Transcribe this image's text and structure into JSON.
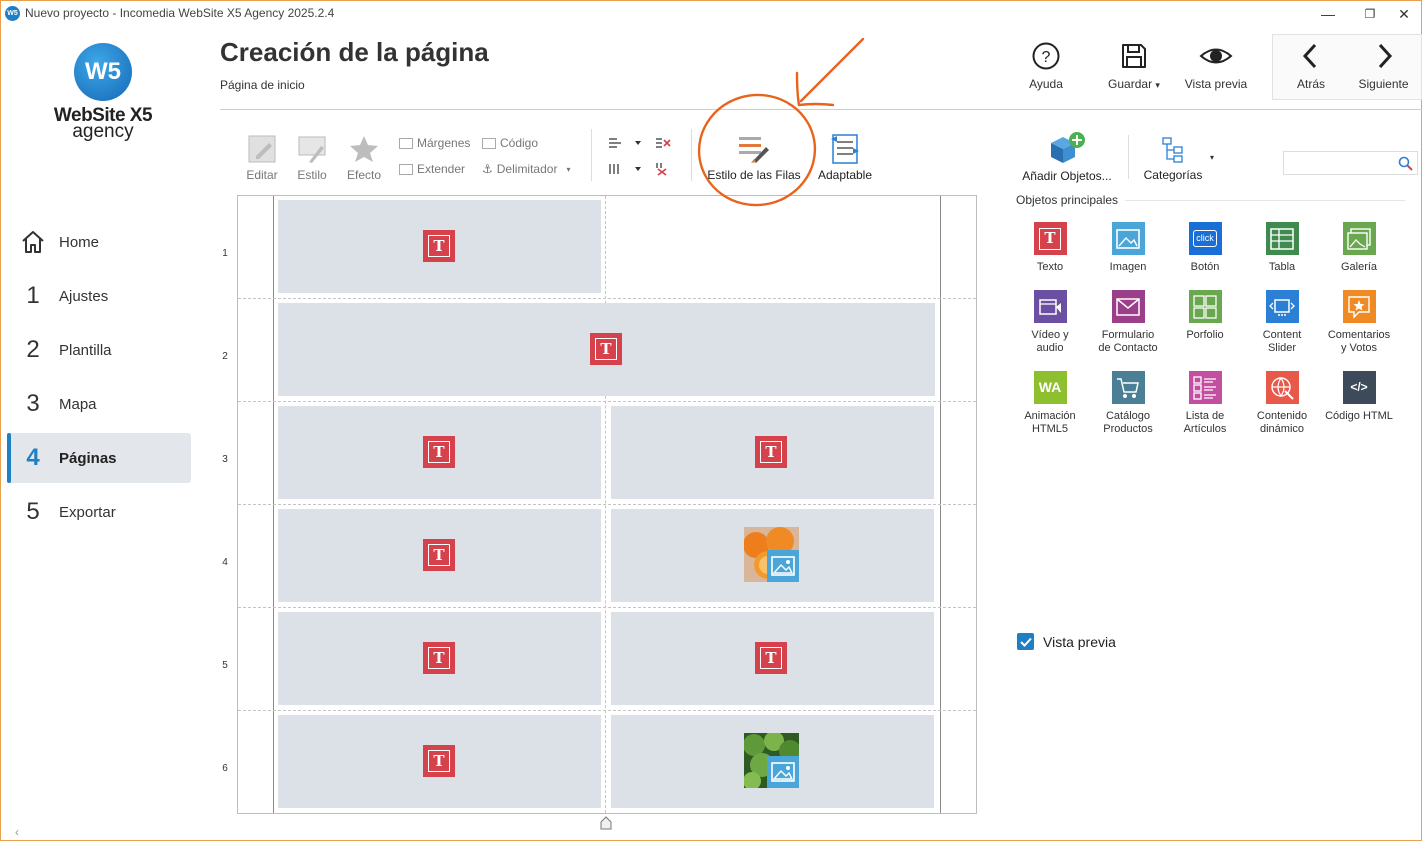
{
  "window": {
    "title": "Nuevo proyecto - Incomedia WebSite X5 Agency 2025.2.4",
    "app_icon_text": "W5",
    "controls": {
      "minimize": "—",
      "maximize": "❐",
      "close": "✕"
    }
  },
  "logo": {
    "mark": "W5",
    "name": "WebSite X5",
    "sub": "agency"
  },
  "sidebar": {
    "items": [
      {
        "num": "",
        "label": "Home",
        "active": false
      },
      {
        "num": "1",
        "label": "Ajustes",
        "active": false
      },
      {
        "num": "2",
        "label": "Plantilla",
        "active": false
      },
      {
        "num": "3",
        "label": "Mapa",
        "active": false
      },
      {
        "num": "4",
        "label": "Páginas",
        "active": true
      },
      {
        "num": "5",
        "label": "Exportar",
        "active": false
      }
    ]
  },
  "header": {
    "title": "Creación de la página",
    "subtitle": "Página de inicio",
    "help": "Ayuda",
    "save": "Guardar",
    "save_arrow": "▾",
    "preview": "Vista previa",
    "back": "Atrás",
    "next": "Siguiente"
  },
  "toolbar": {
    "edit": "Editar",
    "style": "Estilo",
    "effect": "Efecto",
    "margins": "Márgenes",
    "code": "Código",
    "extend": "Extender",
    "delimiter": "Delimitador",
    "row_style": "Estilo de las Filas",
    "adaptive": "Adaptable",
    "add_objects": "Añadir Objetos...",
    "categories": "Categorías"
  },
  "grid": {
    "rows": [
      "1",
      "2",
      "3",
      "4",
      "5",
      "6"
    ],
    "text_glyph": "T"
  },
  "objects_panel": {
    "header": "Objetos principales",
    "items": [
      {
        "label": "Texto",
        "icon": "text-icon",
        "color": "#d6424c"
      },
      {
        "label": "Imagen",
        "icon": "image-icon",
        "color": "#4aa6d9"
      },
      {
        "label": "Botón",
        "icon": "button-icon",
        "color": "#1a6fd6",
        "icon_text": "click"
      },
      {
        "label": "Tabla",
        "icon": "table-icon",
        "color": "#3f8a4f"
      },
      {
        "label": "Galería",
        "icon": "gallery-icon",
        "color": "#6aa84f"
      },
      {
        "label": "Vídeo y\naudio",
        "icon": "video-icon",
        "color": "#6b4fa3"
      },
      {
        "label": "Formulario\nde Contacto",
        "icon": "form-icon",
        "color": "#9c3f8a"
      },
      {
        "label": "Porfolio",
        "icon": "portfolio-icon",
        "color": "#6aa84f"
      },
      {
        "label": "Content\nSlider",
        "icon": "slider-icon",
        "color": "#2b7fd4"
      },
      {
        "label": "Comentarios\ny Votos",
        "icon": "comments-icon",
        "color": "#f08a24"
      },
      {
        "label": "Animación\nHTML5",
        "icon": "animation-icon",
        "color": "#8dbf2f",
        "icon_text": "WA"
      },
      {
        "label": "Catálogo\nProductos",
        "icon": "catalog-icon",
        "color": "#4a7f95"
      },
      {
        "label": "Lista de\nArtículos",
        "icon": "articles-icon",
        "color": "#c34fa3"
      },
      {
        "label": "Contenido\ndinámico",
        "icon": "dynamic-icon",
        "color": "#e8594a"
      },
      {
        "label": "Código HTML",
        "icon": "html-code-icon",
        "color": "#3c4a5a",
        "icon_text": "</>"
      }
    ]
  },
  "search": {
    "placeholder": ""
  },
  "preview_toggle": {
    "label": "Vista previa",
    "checked": true
  }
}
